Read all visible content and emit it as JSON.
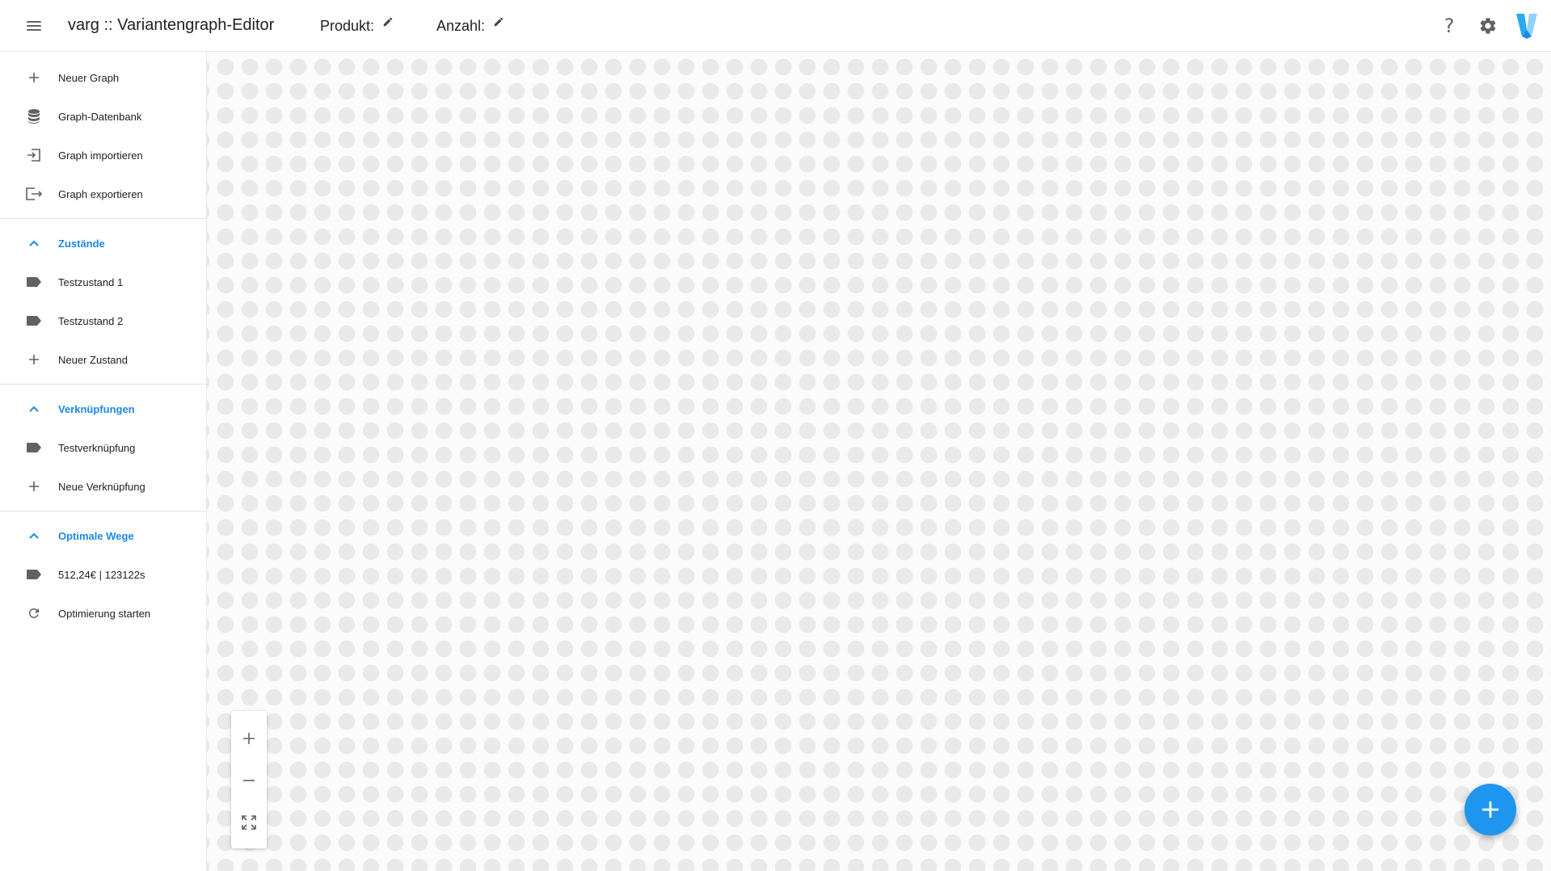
{
  "app": {
    "title": "varg :: Variantengraph-Editor",
    "produkt_label": "Produkt:",
    "anzahl_label": "Anzahl:",
    "accent_color": "#1e96f0"
  },
  "header_icons": {
    "menu": "menu-icon",
    "help": "help-icon",
    "settings": "gear-icon",
    "logo": "v-logo-icon",
    "help_glyph": "?"
  },
  "sidebar": {
    "items": [
      {
        "label": "Neuer Graph",
        "icon": "plus-icon"
      },
      {
        "label": "Graph-Datenbank",
        "icon": "database-icon"
      },
      {
        "label": "Graph importieren",
        "icon": "import-icon"
      },
      {
        "label": "Graph exportieren",
        "icon": "export-icon"
      }
    ],
    "zustaende": {
      "header": "Zustände",
      "items": [
        {
          "label": "Testzustand 1",
          "icon": "label-icon"
        },
        {
          "label": "Testzustand 2",
          "icon": "label-icon"
        },
        {
          "label": "Neuer Zustand",
          "icon": "plus-icon"
        }
      ]
    },
    "verknuepfungen": {
      "header": "Verknüpfungen",
      "items": [
        {
          "label": "Testverknüpfung",
          "icon": "label-icon"
        },
        {
          "label": "Neue Verknüpfung",
          "icon": "plus-icon"
        }
      ]
    },
    "optimale_wege": {
      "header": "Optimale Wege",
      "items": [
        {
          "label": "512,24€ | 123122s",
          "icon": "label-icon"
        },
        {
          "label": "Optimierung starten",
          "icon": "refresh-icon"
        }
      ]
    }
  },
  "canvas": {
    "zoom_in": "zoom-in-icon",
    "zoom_out": "zoom-out-icon",
    "fit": "fit-screen-icon",
    "fab": "add-icon"
  }
}
